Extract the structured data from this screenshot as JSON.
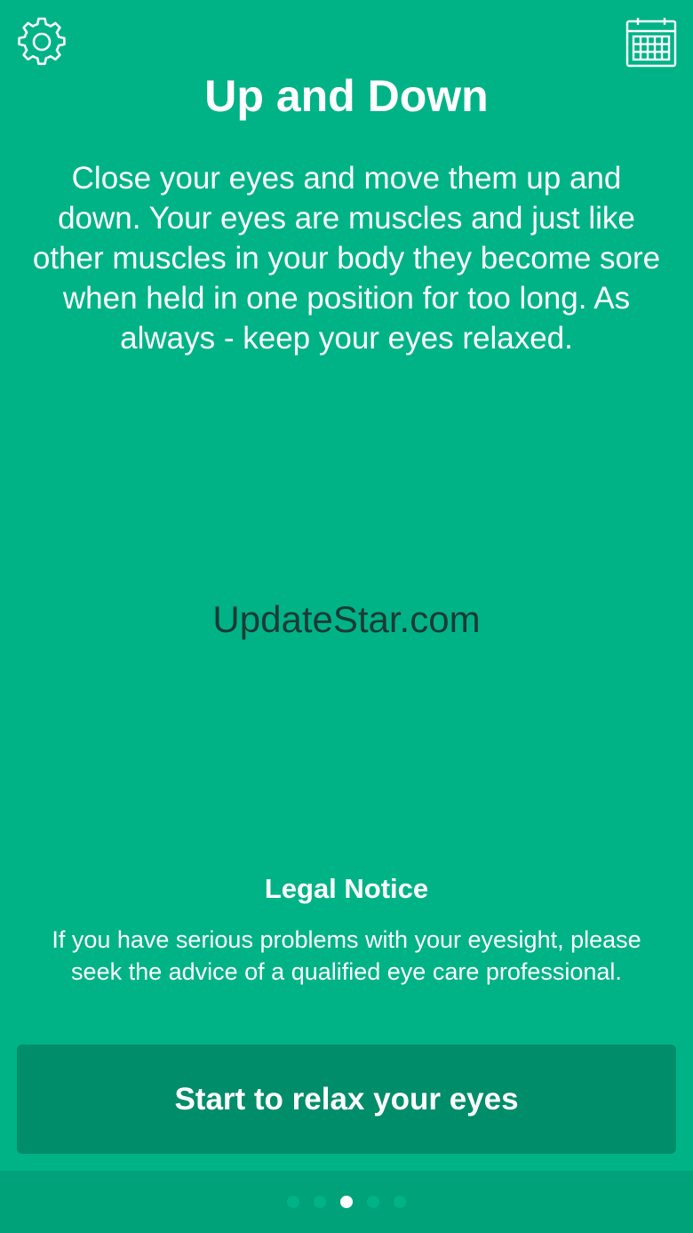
{
  "header": {
    "settings_icon": "gear-icon",
    "calendar_icon": "calendar-icon"
  },
  "exercise": {
    "title": "Up and Down",
    "description": "Close your eyes and move them up and down. Your eyes are muscles and just like other muscles in your body they become sore when held in one position for too long. As always - keep your eyes relaxed."
  },
  "watermark": "UpdateStar.com",
  "legal": {
    "title": "Legal Notice",
    "text": "If you have serious problems with your eyesight, please seek the advice of a qualified eye care professional."
  },
  "start_button": {
    "label": "Start to relax your eyes"
  },
  "pagination": {
    "total": 5,
    "active_index": 2
  },
  "colors": {
    "background": "#00b386",
    "button": "#008d6a",
    "bottom_bar": "#00a27a",
    "watermark_text": "#1d3a37"
  }
}
